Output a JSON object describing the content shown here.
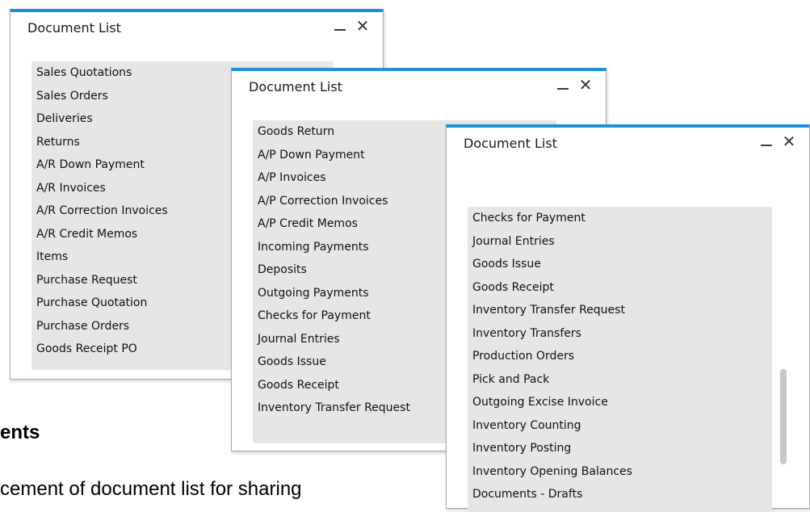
{
  "background": {
    "heading_fragment": "ents",
    "paragraph_fragment": "cement of document list for sharing"
  },
  "windows": [
    {
      "title": "Document List",
      "items": [
        "Sales Quotations",
        "Sales Orders",
        "Deliveries",
        "Returns",
        "A/R Down Payment",
        "A/R Invoices",
        "A/R Correction Invoices",
        "A/R Credit Memos",
        "Items",
        "Purchase Request",
        "Purchase Quotation",
        "Purchase Orders",
        "Goods Receipt PO"
      ]
    },
    {
      "title": "Document List",
      "items": [
        "Goods Return",
        "A/P Down Payment",
        "A/P Invoices",
        "A/P Correction Invoices",
        "A/P Credit Memos",
        "Incoming Payments",
        "Deposits",
        "Outgoing Payments",
        "Checks for Payment",
        "Journal Entries",
        "Goods Issue",
        "Goods Receipt",
        "Inventory Transfer Request"
      ]
    },
    {
      "title": "Document List",
      "items": [
        "Checks for Payment",
        "Journal Entries",
        "Goods Issue",
        "Goods Receipt",
        "Inventory Transfer Request",
        "Inventory Transfers",
        "Production Orders",
        "Pick and Pack",
        "Outgoing Excise Invoice",
        "Inventory Counting",
        "Inventory Posting",
        "Inventory Opening Balances",
        "Documents - Drafts"
      ]
    }
  ],
  "colors": {
    "accent": "#1e90d6",
    "list_background": "#e6e6e6",
    "window_border": "#a9a9a9"
  },
  "icons": {
    "minimize": "minimize-icon",
    "close": "close-icon"
  }
}
